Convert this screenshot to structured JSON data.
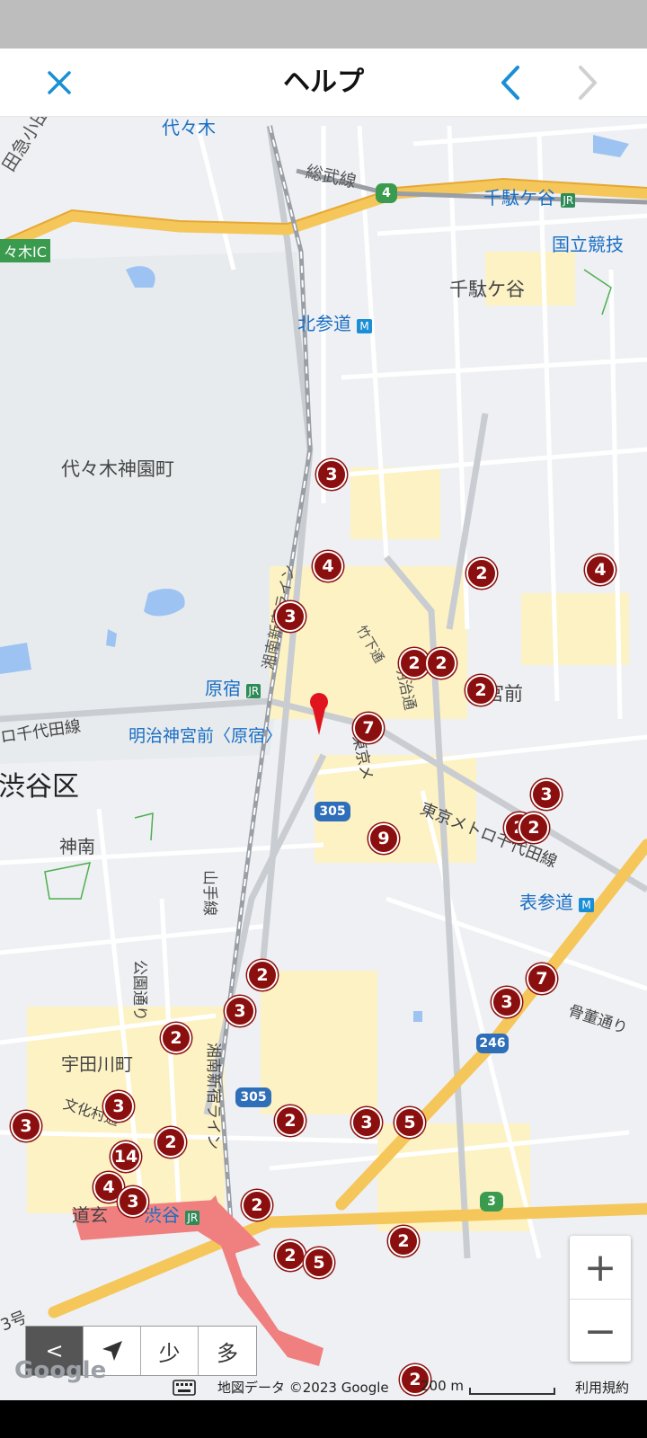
{
  "header": {
    "title": "ヘルプ",
    "close_icon": "close-icon",
    "back_icon": "chevron-left-icon",
    "forward_icon": "chevron-right-icon",
    "accent": "#1a8fd6"
  },
  "map": {
    "labels": {
      "yoyogi_top": "代々木",
      "odakyu": "田急小田原線",
      "sobu": "総武線",
      "sendagaya_station": "千駄ケ谷",
      "kokuritsu": "国立競技",
      "sendagaya_area": "千駄ケ谷",
      "yoyogi_ic": "々木IC",
      "kitasando": "北参道",
      "yoyogi_kamizono": "代々木神園町",
      "shonan_shinjuku_1": "湘南新宿ライン",
      "takeshita": "竹下通",
      "meiji_dori": "明治通",
      "jingumae": "宮前",
      "harajuku": "原宿",
      "chiyoda_line_w": "ロ千代田線",
      "meiji_jingumae": "明治神宮前〈原宿〉",
      "shibuya_ku": "渋谷区",
      "tokyo_metro": "東京メトロ千代田線",
      "tokyo_metro_2": "東京メ",
      "jinnan": "神南",
      "yamanote": "山手線",
      "omotesando": "表参道",
      "koen_dori": "公園通り",
      "kotto_dori": "骨董通り",
      "udagawacho": "宇田川町",
      "bunka_mura": "文化村通",
      "shonan_shinjuku_2": "湘南新宿ライン",
      "dogenzaka": "道玄",
      "shibuya": "渋谷",
      "route3": "3号",
      "rt_4": "4",
      "rt_305a": "305",
      "rt_305b": "305",
      "rt_246": "246",
      "rt_3": "3"
    },
    "markers": [
      "3",
      "4",
      "2",
      "4",
      "3",
      "2",
      "2",
      "2",
      "7",
      "3",
      "2",
      "2",
      "9",
      "7",
      "2",
      "3",
      "3",
      "2",
      "3",
      "2",
      "3",
      "5",
      "14",
      "4",
      "3",
      "2",
      "2",
      "2",
      "5",
      "2",
      "3",
      "2"
    ]
  },
  "controls": {
    "zoom_in": "+",
    "zoom_out": "−",
    "back_label": "<",
    "locate_icon": "navigation-arrow-icon",
    "fewer_label": "少",
    "more_label": "多"
  },
  "attribution": {
    "google": "Google",
    "map_data": "地図データ ©2023 Google",
    "scale": "200 m",
    "terms": "利用規約",
    "keyboard_icon": "keyboard-icon"
  },
  "colors": {
    "marker": "#8b0f0f",
    "expressway": "#f5c65a",
    "station_label": "#1a6fc4",
    "water": "#9dc3f2",
    "shibuya_area": "#f08080"
  }
}
